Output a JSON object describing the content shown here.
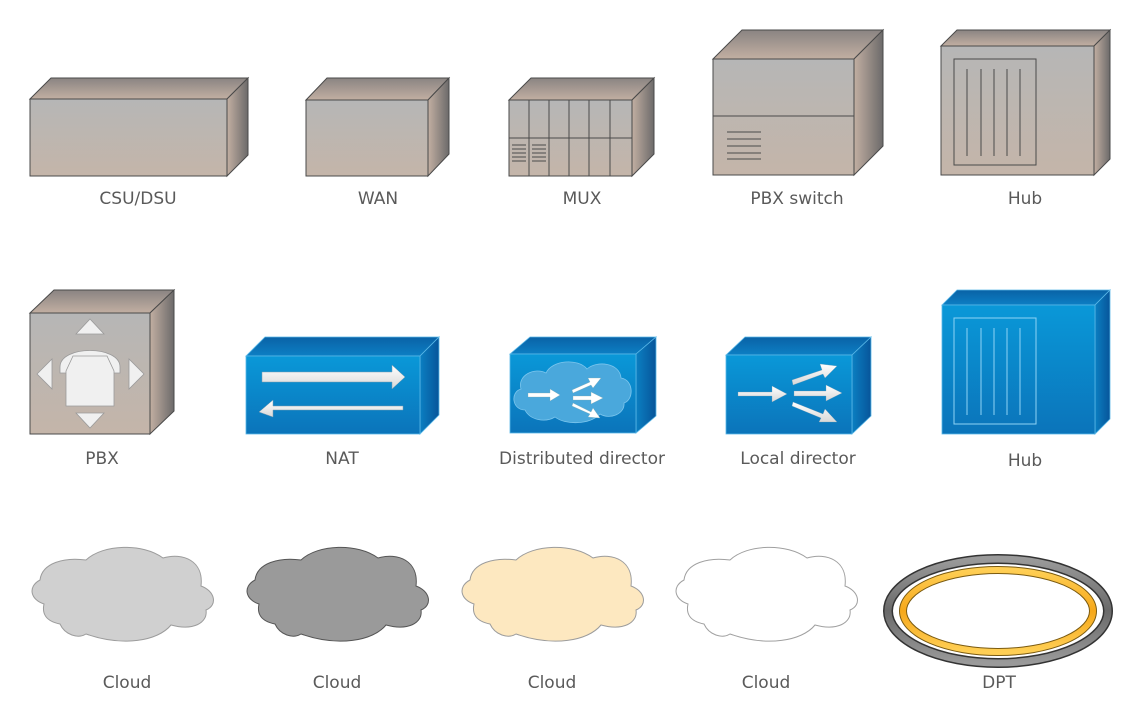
{
  "palette": {
    "gray_front_top": "#b8b8b8",
    "gray_front_bottom": "#c3b5aa",
    "gray_top_dark": "#8a8280",
    "gray_top_light": "#c4b2a6",
    "gray_side_light": "#bfaea2",
    "gray_side_dark": "#6e6b6a",
    "gray_stroke": "#4a4a4a",
    "blue_front_top": "#0a97d6",
    "blue_front_bottom": "#0b76bb",
    "blue_top": "#0e6fb3",
    "blue_side": "#0a5fa0",
    "blue_stroke": "#5ab8e8",
    "cloud_light": "#d0d0d0",
    "cloud_dark": "#9a9a9a",
    "cloud_cream": "#fde8c0",
    "cloud_white": "#ffffff",
    "dpt_outer": "#8a8a8a",
    "dpt_inner": "#fcb72a"
  },
  "shapes": [
    {
      "id": "csu-dsu",
      "label": "CSU/DSU",
      "kind": "gray-box"
    },
    {
      "id": "wan",
      "label": "WAN",
      "kind": "gray-box"
    },
    {
      "id": "mux",
      "label": "MUX",
      "kind": "gray-box-mux"
    },
    {
      "id": "pbx-switch",
      "label": "PBX switch",
      "kind": "gray-box-pbx-switch"
    },
    {
      "id": "hub-gray",
      "label": "Hub",
      "kind": "gray-box-hub"
    },
    {
      "id": "pbx",
      "label": "PBX",
      "kind": "gray-box-pbx"
    },
    {
      "id": "nat",
      "label": "NAT",
      "kind": "blue-box-nat"
    },
    {
      "id": "distributed-director",
      "label": "Distributed director",
      "kind": "blue-box-distributed-director"
    },
    {
      "id": "local-director",
      "label": "Local director",
      "kind": "blue-box-local-director"
    },
    {
      "id": "hub-blue",
      "label": "Hub",
      "kind": "blue-box-hub"
    },
    {
      "id": "cloud-light",
      "label": "Cloud",
      "kind": "cloud",
      "fill": "#d0d0d0"
    },
    {
      "id": "cloud-dark",
      "label": "Cloud",
      "kind": "cloud",
      "fill": "#9a9a9a"
    },
    {
      "id": "cloud-cream",
      "label": "Cloud",
      "kind": "cloud",
      "fill": "#fde8c0"
    },
    {
      "id": "cloud-white",
      "label": "Cloud",
      "kind": "cloud",
      "fill": "#ffffff"
    },
    {
      "id": "dpt",
      "label": "DPT",
      "kind": "dpt-ring"
    }
  ]
}
